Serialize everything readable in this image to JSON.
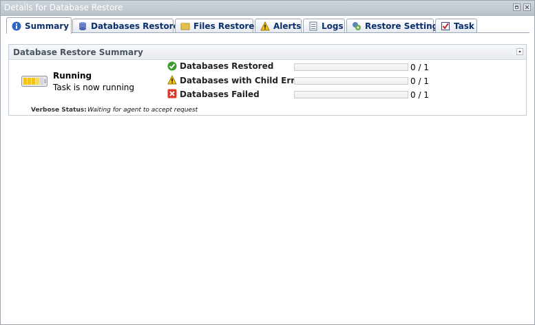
{
  "window": {
    "title": "Details for Database Restore"
  },
  "tabs": [
    {
      "label": "Summary",
      "icon": "info-icon",
      "active": true
    },
    {
      "label": "Databases Restored",
      "icon": "database-icon",
      "active": false
    },
    {
      "label": "Files Restored",
      "icon": "folder-icon",
      "active": false
    },
    {
      "label": "Alerts",
      "icon": "warning-icon",
      "active": false
    },
    {
      "label": "Logs",
      "icon": "log-icon",
      "active": false
    },
    {
      "label": "Restore Settings",
      "icon": "settings-icon",
      "active": false
    },
    {
      "label": "Task",
      "icon": "task-icon",
      "active": false
    }
  ],
  "summary": {
    "header": "Database Restore Summary",
    "state": "Running",
    "state_text": "Task is now running",
    "stats": [
      {
        "label": "Databases Restored",
        "icon": "check-icon",
        "color": "#3a9c2d",
        "count": "0 / 1",
        "fraction": 0
      },
      {
        "label": "Databases with Child Errors",
        "icon": "warning-icon",
        "color": "#e8b400",
        "count": "0 / 1",
        "fraction": 0
      },
      {
        "label": "Databases Failed",
        "icon": "error-icon",
        "color": "#d93a2b",
        "count": "0 / 1",
        "fraction": 0
      }
    ],
    "verbose_label": "Verbose Status:",
    "verbose_value": "Waiting for agent to accept request"
  }
}
